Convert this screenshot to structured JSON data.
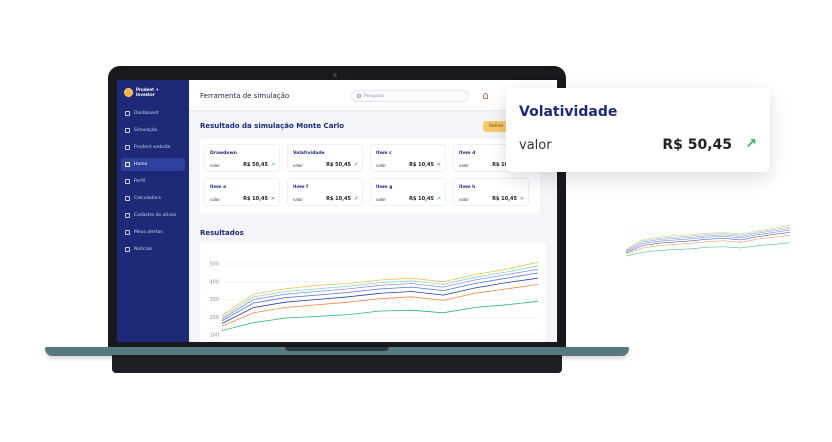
{
  "app": {
    "logo_text_1": "Prudent",
    "logo_text_2": "Investor",
    "page_title": "Ferramenta de simulação"
  },
  "search": {
    "placeholder": "Pesquisa"
  },
  "sidebar": {
    "items": [
      {
        "label": "Dashboard",
        "icon": "grid-icon",
        "active": false
      },
      {
        "label": "Simulação",
        "icon": "chart-icon",
        "active": false
      },
      {
        "label": "Prudent website",
        "icon": "monitor-icon",
        "active": false
      },
      {
        "label": "Home",
        "icon": "home-icon",
        "active": true
      },
      {
        "label": "Perfil",
        "icon": "user-icon",
        "active": false
      },
      {
        "label": "Calculadora",
        "icon": "calculator-icon",
        "active": false
      },
      {
        "label": "Cadastro de ativos",
        "icon": "list-icon",
        "active": false
      },
      {
        "label": "Meus alertas",
        "icon": "bell-icon",
        "active": false
      },
      {
        "label": "Notícias",
        "icon": "news-icon",
        "active": false
      }
    ]
  },
  "simulation": {
    "title": "Resultado da simulação Monte Carlo",
    "refresh_label": "Refres",
    "cards": [
      {
        "title": "Drawdown",
        "label": "valor",
        "value": "R$ 50,45",
        "trend": "up"
      },
      {
        "title": "Volatividade",
        "label": "valor",
        "value": "R$ 50,45",
        "trend": "up"
      },
      {
        "title": "Item c",
        "label": "valor",
        "value": "R$ 10,45",
        "trend": "down"
      },
      {
        "title": "Item d",
        "label": "valor",
        "value": "R$ 10,45",
        "trend": "down"
      },
      {
        "title": "Item e",
        "label": "valor",
        "value": "R$ 10,45",
        "trend": "down"
      },
      {
        "title": "Item f",
        "label": "valor",
        "value": "R$ 10,45",
        "trend": "up"
      },
      {
        "title": "Item g",
        "label": "valor",
        "value": "R$ 10,45",
        "trend": "up"
      },
      {
        "title": "Item h",
        "label": "valor",
        "value": "R$ 10,45",
        "trend": "down"
      }
    ]
  },
  "results": {
    "title": "Resultados",
    "yticks": [
      "500",
      "400",
      "300",
      "200",
      "100"
    ],
    "colors": [
      "#f2c14e",
      "#7fd6d2",
      "#9b8fe0",
      "#4e79d8",
      "#2a3f9c",
      "#f08a4b",
      "#2bb673"
    ]
  },
  "popup": {
    "title": "Volatividade",
    "label": "valor",
    "value": "R$ 50,45",
    "trend": "up"
  },
  "chart_data": {
    "type": "line",
    "ylim": [
      100,
      500
    ],
    "x": [
      0,
      10,
      20,
      30,
      40,
      50,
      60,
      70,
      80,
      90,
      100
    ],
    "series": [
      {
        "values": [
          210,
          330,
          360,
          380,
          390,
          410,
          420,
          400,
          440,
          470,
          510
        ]
      },
      {
        "values": [
          200,
          315,
          345,
          360,
          375,
          395,
          405,
          385,
          425,
          455,
          490
        ]
      },
      {
        "values": [
          190,
          300,
          330,
          345,
          360,
          380,
          390,
          370,
          410,
          440,
          470
        ]
      },
      {
        "values": [
          180,
          280,
          310,
          325,
          340,
          360,
          370,
          350,
          390,
          420,
          450
        ]
      },
      {
        "values": [
          165,
          255,
          285,
          300,
          315,
          335,
          345,
          325,
          365,
          395,
          420
        ]
      },
      {
        "values": [
          150,
          225,
          255,
          270,
          285,
          305,
          315,
          295,
          335,
          360,
          385
        ]
      },
      {
        "values": [
          125,
          170,
          195,
          205,
          215,
          235,
          240,
          225,
          255,
          270,
          290
        ]
      }
    ]
  }
}
